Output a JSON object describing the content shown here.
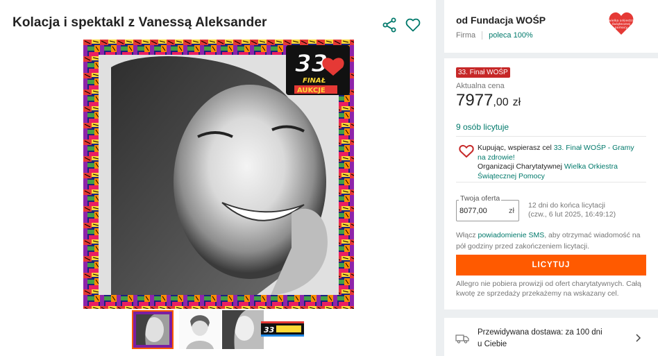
{
  "listing": {
    "title": "Kolacja i spektakl z Vanessą Aleksander"
  },
  "image_badge": {
    "number": "33",
    "line1": "FINAŁ",
    "line2": "AUKCJE",
    "heart_text": "wielka orkiestra świątecznej pomocy"
  },
  "thumbnails": [
    "Zdjęcie 1",
    "Zdjęcie 2",
    "Zdjęcie 3",
    "Zdjęcie 4"
  ],
  "seller": {
    "name": "od Fundacja WOŚP",
    "type": "Firma",
    "rating": "poleca 100%",
    "logo_text": "wielka orkiestra świątecznej pomocy"
  },
  "offer": {
    "badge": "33. Finał WOŚP",
    "price_label": "Aktualna cena",
    "price_int": "7977",
    "price_dec": ",00",
    "currency": "zł",
    "bidders": "9 osób licytuje",
    "charity": {
      "text1": "Kupując, wspierasz cel ",
      "link1": "33. Finał WOŚP - Gramy na zdrowie!",
      "text2": "Organizacji Charytatywnej ",
      "link2": "Wielka Orkiestra Świątecznej Pomocy"
    },
    "bid": {
      "legend": "Twoja oferta",
      "value": "8077,00",
      "currency": "zł"
    },
    "time_left": {
      "line1": "12 dni do końca licytacji",
      "line2": "(czw., 6 lut 2025, 16:49:12)"
    },
    "sms": {
      "text1": "Włącz ",
      "link": "powiadomienie SMS",
      "text2": ", aby otrzymać wiadomość na pół godziny przed zakończeniem licytacji."
    },
    "button": "LICYTUJ",
    "fee_note": "Allegro nie pobiera prowizji od ofert charytatywnych. Całą kwotę ze sprzedaży przekażemy na wskazany cel."
  },
  "delivery": {
    "line1": "Przewidywana dostawa: za 100 dni",
    "line2": "u Ciebie"
  },
  "colors": {
    "accent": "#ff5a00",
    "link": "#00796b",
    "badge": "#c62828"
  }
}
